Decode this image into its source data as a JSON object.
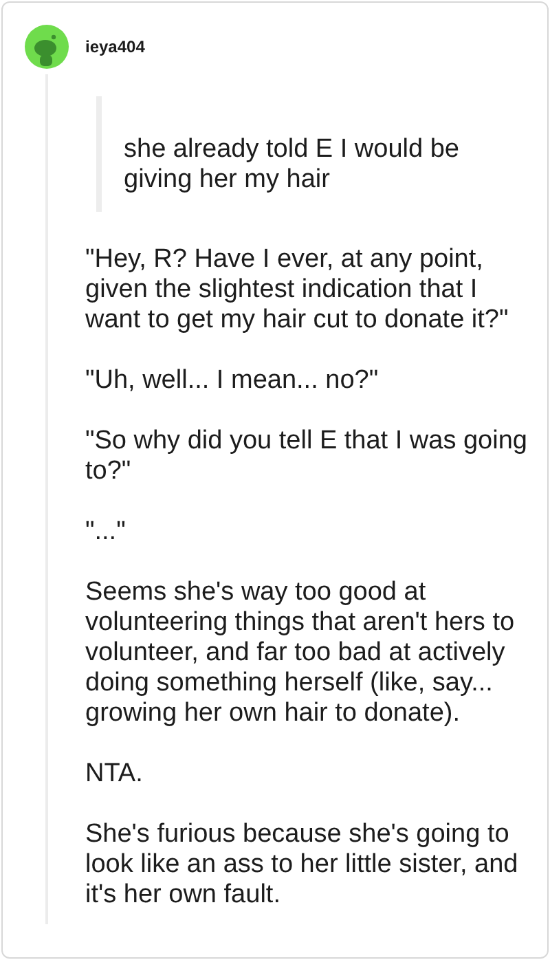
{
  "comment": {
    "username": "ieya404",
    "quote": "she already told E I would be giving her my hair",
    "paragraphs": [
      "\"Hey, R? Have I ever, at any point, given the slightest indication that I want to get my hair cut to donate it?\"",
      "\"Uh, well... I mean... no?\"",
      "\"So why did you tell E that I was going to?\"",
      "\"...\"",
      "Seems she's way too good at volunteering things that aren't hers to volunteer, and far too bad at actively doing something herself (like, say... growing her own hair to donate).",
      "NTA.",
      "She's furious because she's going to look like an ass to her little sister, and it's her own fault."
    ]
  }
}
